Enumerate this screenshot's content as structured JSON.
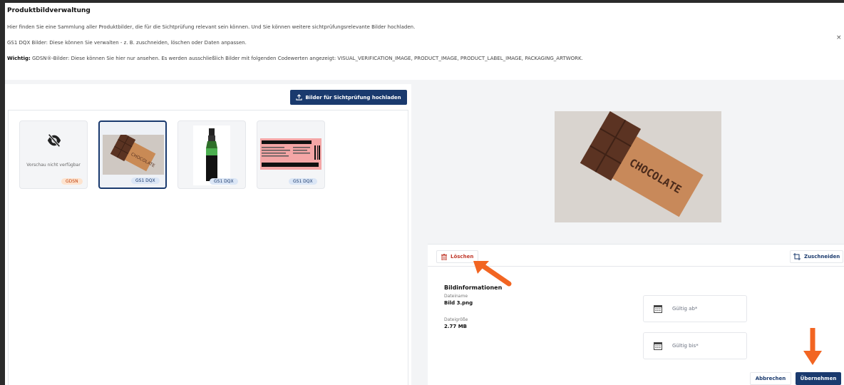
{
  "header": {
    "title": "Produktbildverwaltung",
    "info_line_1": "Hier finden Sie eine Sammlung aller Produktbilder, die für die Sichtprüfung relevant sein können. Und Sie können weitere sichtprüfungsrelevante Bilder hochladen.",
    "info_line_2": "GS1 DQX Bilder: Diese können Sie verwalten - z. B. zuschneiden, löschen oder Daten anpassen.",
    "info_line_3_bold": "Wichtig:",
    "info_line_3": " GDSN®-Bilder: Diese können Sie hier nur ansehen. Es werden ausschließlich Bilder mit folgenden Codewerten angezeigt: VISUAL_VERIFICATION_IMAGE, PRODUCT_IMAGE, PRODUCT_LABEL_IMAGE, PACKAGING_ARTWORK.",
    "close_label": "×"
  },
  "left": {
    "upload_label": "Bilder für Sichtprüfung hochladen",
    "upload_icon": "upload-icon",
    "thumbnails": [
      {
        "badge": "GDSN",
        "no_preview": "Vorschau nicht verfügbar",
        "icon": "eye-slash-icon"
      },
      {
        "badge": "GS1 DQX",
        "selected": true
      },
      {
        "badge": "GS1 DQX"
      },
      {
        "badge": "GS1 DQX"
      }
    ]
  },
  "right": {
    "delete_label": "Löschen",
    "delete_icon": "trash-icon",
    "crop_label": "Zuschneiden",
    "crop_icon": "crop-icon",
    "meta_title": "Bildinformationen",
    "filename_label": "Dateiname",
    "filename_value": "Bild 3.png",
    "filesize_label": "Dateigröße",
    "filesize_value": "2.77 MB",
    "valid_from_placeholder": "Gültig ab*",
    "valid_to_placeholder": "Gültig bis*",
    "calendar_icon": "calendar-icon",
    "cancel_label": "Abbrechen",
    "apply_label": "Übernehmen"
  },
  "colors": {
    "primary": "#1a3a6e",
    "danger": "#c0392b",
    "annotation_arrow": "#f26522",
    "gdsn_badge": "#fde3cf",
    "dqx_badge": "#dbe6f6"
  }
}
